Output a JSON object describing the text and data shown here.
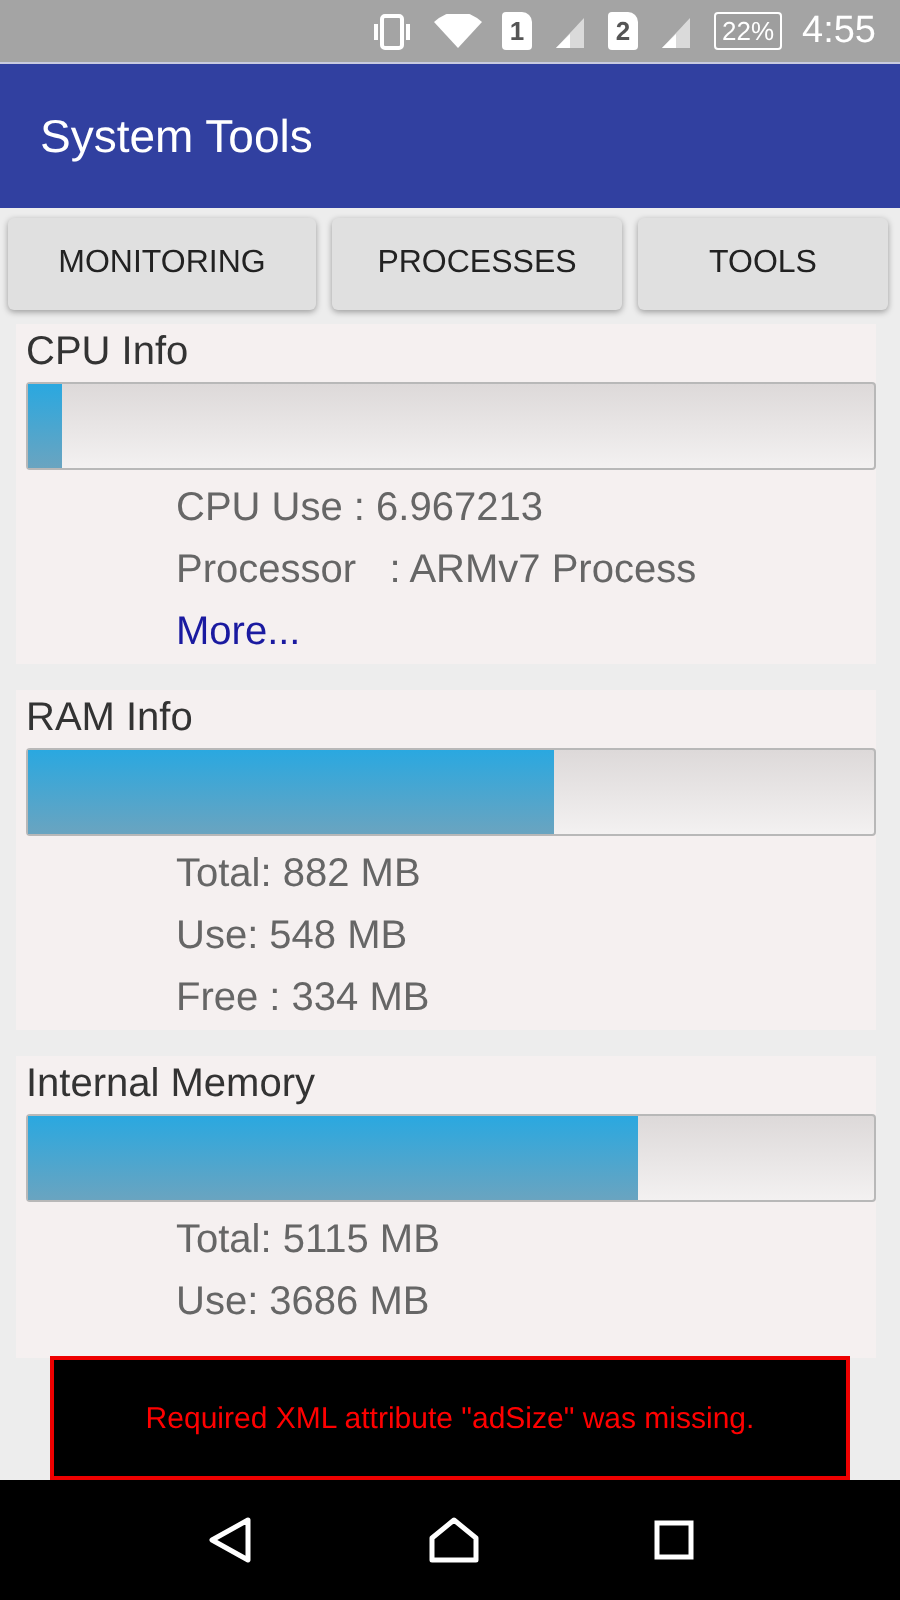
{
  "status_bar": {
    "battery": "22%",
    "time": "4:55",
    "sim_labels": [
      "1",
      "2"
    ]
  },
  "app_bar": {
    "title": "System Tools"
  },
  "tabs": [
    {
      "label": "MONITORING"
    },
    {
      "label": "PROCESSES"
    },
    {
      "label": "TOOLS"
    }
  ],
  "sections": [
    {
      "title": "CPU Info",
      "level": 0.04,
      "lines": [
        "CPU Use : 6.967213",
        "Processor   : ARMv7 Process"
      ],
      "link": "More..."
    },
    {
      "title": "RAM Info",
      "level": 0.621,
      "lines": [
        "Total: 882 MB",
        "Use: 548 MB",
        "Free : 334 MB"
      ]
    },
    {
      "title": "Internal Memory",
      "level": 0.72,
      "lines": [
        "Total: 5115 MB",
        "Use: 3686 MB"
      ]
    }
  ],
  "ad_error": "Required XML attribute \"adSize\" was missing."
}
